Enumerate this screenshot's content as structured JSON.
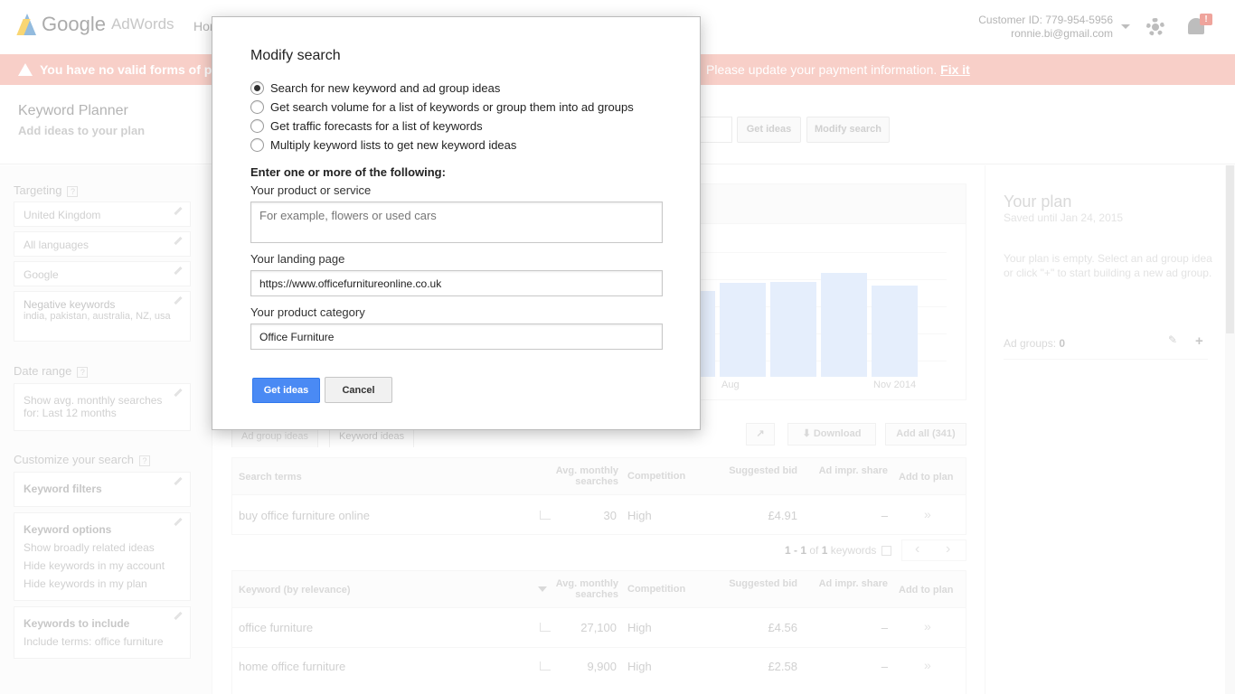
{
  "header": {
    "logo_google": "Google",
    "logo_adwords": "AdWords",
    "nav_home": "Hor",
    "customer_id": "Customer ID: 779-954-5956",
    "email": "ronnie.bi@gmail.com",
    "notification_count": "!"
  },
  "alert": {
    "left_text": "You have no valid forms of pay",
    "right_text": "Please update your payment information.",
    "link": "Fix it"
  },
  "subheader": {
    "title": "Keyword Planner",
    "subtitle": "Add ideas to your plan",
    "get_ideas": "Get ideas",
    "modify_search": "Modify search"
  },
  "sidebar": {
    "targeting_label": "Targeting",
    "location": "United Kingdom",
    "language": "All languages",
    "network": "Google",
    "negative_label": "Negative keywords",
    "negative_value": "india, pakistan, australia, NZ, usa",
    "date_label": "Date range",
    "date_value": "Show avg. monthly searches for: Last 12 months",
    "customize_label": "Customize your search",
    "keyword_filters": "Keyword filters",
    "keyword_options": "Keyword options",
    "opt1": "Show broadly related ideas",
    "opt2": "Hide keywords in my account",
    "opt3": "Hide keywords in my plan",
    "include_label": "Keywords to include",
    "include_value": "Include terms: office furniture"
  },
  "plan": {
    "title": "Your plan",
    "saved": "Saved until Jan 24, 2015",
    "empty": "Your plan is empty. Select an ad group idea or click \"+\" to start building a new ad group.",
    "ad_groups_label": "Ad groups:",
    "ad_groups_count": "0",
    "plus": "+"
  },
  "chart_data": {
    "type": "bar",
    "categories": [
      "",
      "Aug",
      "",
      "",
      "Nov 2014"
    ],
    "values": [
      0.76,
      0.83,
      0.84,
      0.92,
      0.81
    ],
    "x_tick_labels": [
      "Aug",
      "Nov 2014"
    ]
  },
  "tabs": {
    "ad_group": "Ad group ideas",
    "keyword": "Keyword ideas",
    "download": "Download",
    "add_all": "Add all (341)"
  },
  "table1": {
    "col_search_terms": "Search terms",
    "col_avg": "Avg. monthly searches",
    "col_competition": "Competition",
    "col_bid": "Suggested bid",
    "col_share": "Ad impr. share",
    "col_add": "Add to plan",
    "row": {
      "term": "buy office furniture online",
      "avg": "30",
      "competition": "High",
      "bid": "£4.91",
      "share": "–",
      "add": "»"
    }
  },
  "pager": {
    "range": "1 - 1",
    "of": "of",
    "total": "1",
    "unit": "keywords"
  },
  "table2": {
    "col_keyword": "Keyword (by relevance)",
    "col_avg": "Avg. monthly searches",
    "col_competition": "Competition",
    "col_bid": "Suggested bid",
    "col_share": "Ad impr. share",
    "col_add": "Add to plan",
    "rows": [
      {
        "term": "office furniture",
        "avg": "27,100",
        "competition": "High",
        "bid": "£4.56",
        "share": "–",
        "add": "»"
      },
      {
        "term": "home office furniture",
        "avg": "9,900",
        "competition": "High",
        "bid": "£2.58",
        "share": "–",
        "add": "»"
      }
    ]
  },
  "modal": {
    "title": "Modify search",
    "options": [
      "Search for new keyword and ad group ideas",
      "Get search volume for a list of keywords or group them into ad groups",
      "Get traffic forecasts for a list of keywords",
      "Multiply keyword lists to get new keyword ideas"
    ],
    "selected_option_index": 0,
    "section_heading": "Enter one or more of the following:",
    "product_label": "Your product or service",
    "product_placeholder": "For example, flowers or used cars",
    "landing_label": "Your landing page",
    "landing_value": "https://www.officefurnitureonline.co.uk",
    "category_label": "Your product category",
    "category_value": "Office Furniture",
    "get_ideas": "Get ideas",
    "cancel": "Cancel"
  },
  "colors": {
    "primary_button": "#4a8af4",
    "alert_bg": "#f2a89c",
    "bar_fill": "#cfe0fa"
  }
}
